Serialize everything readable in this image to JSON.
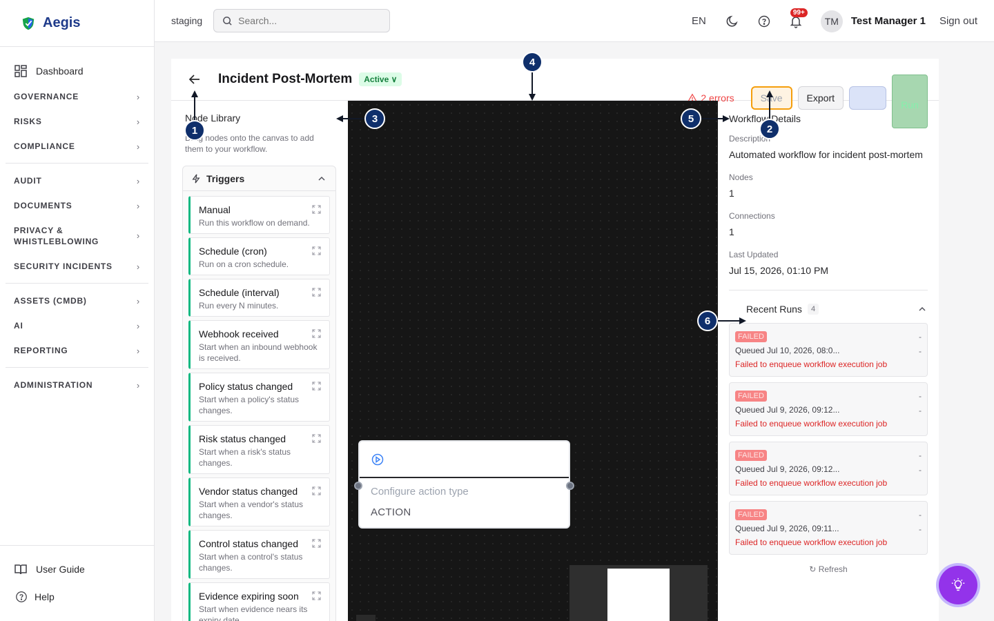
{
  "app": {
    "name": "Aegis"
  },
  "sidebar": {
    "dashboard": "Dashboard",
    "items": [
      {
        "label": "GOVERNANCE"
      },
      {
        "label": "RISKS"
      },
      {
        "label": "COMPLIANCE"
      },
      {
        "label": "AUDIT"
      },
      {
        "label": "DOCUMENTS"
      },
      {
        "label": "PRIVACY & WHISTLEBLOWING"
      },
      {
        "label": "SECURITY INCIDENTS"
      },
      {
        "label": "ASSETS (CMDB)"
      },
      {
        "label": "AI"
      },
      {
        "label": "REPORTING"
      },
      {
        "label": "ADMINISTRATION"
      }
    ],
    "user_guide": "User Guide",
    "help": "Help"
  },
  "topbar": {
    "env": "staging",
    "search_placeholder": "Search...",
    "lang": "EN",
    "notif_badge": "99+",
    "avatar": "TM",
    "user": "Test Manager 1",
    "signout": "Sign out"
  },
  "workflow": {
    "title": "Incident Post-Mortem",
    "status": "Active",
    "errors": "2 errors",
    "save": "Save",
    "export": "Export",
    "run": "Run"
  },
  "library": {
    "title": "Node Library",
    "desc": "Drag nodes onto the canvas to add them to your workflow.",
    "group": "Triggers",
    "nodes": [
      {
        "name": "Manual",
        "desc": "Run this workflow on demand."
      },
      {
        "name": "Schedule (cron)",
        "desc": "Run on a cron schedule."
      },
      {
        "name": "Schedule (interval)",
        "desc": "Run every N minutes."
      },
      {
        "name": "Webhook received",
        "desc": "Start when an inbound webhook is received."
      },
      {
        "name": "Policy status changed",
        "desc": "Start when a policy's status changes."
      },
      {
        "name": "Risk status changed",
        "desc": "Start when a risk's status changes."
      },
      {
        "name": "Vendor status changed",
        "desc": "Start when a vendor's status changes."
      },
      {
        "name": "Control status changed",
        "desc": "Start when a control's status changes."
      },
      {
        "name": "Evidence expiring soon",
        "desc": "Start when evidence nears its expiry date."
      }
    ]
  },
  "canvas": {
    "node_subtitle": "Configure action type",
    "node_type": "ACTION"
  },
  "details": {
    "title": "Workflow Details",
    "description_label": "Description",
    "description": "Automated workflow for incident post-mortem",
    "nodes_label": "Nodes",
    "nodes": "1",
    "connections_label": "Connections",
    "connections": "1",
    "updated_label": "Last Updated",
    "updated": "Jul 15, 2026, 01:10 PM",
    "runs_title": "Recent Runs",
    "runs_count": "4",
    "runs": [
      {
        "status": "FAILED",
        "queued": "Queued Jul 10, 2026, 08:0...",
        "dash1": "-",
        "dash2": "-",
        "error": "Failed to enqueue workflow execution job"
      },
      {
        "status": "FAILED",
        "queued": "Queued Jul 9, 2026, 09:12...",
        "dash1": "-",
        "dash2": "-",
        "error": "Failed to enqueue workflow execution job"
      },
      {
        "status": "FAILED",
        "queued": "Queued Jul 9, 2026, 09:12...",
        "dash1": "-",
        "dash2": "-",
        "error": "Failed to enqueue workflow execution job"
      },
      {
        "status": "FAILED",
        "queued": "Queued Jul 9, 2026, 09:11...",
        "dash1": "-",
        "dash2": "-",
        "error": "Failed to enqueue workflow execution job"
      }
    ],
    "refresh": "Refresh"
  },
  "annotations": [
    "1",
    "2",
    "3",
    "4",
    "5",
    "6"
  ],
  "colors": {
    "accent": "#1e3a8a",
    "trigger_border": "#10b981",
    "canvas_bg": "#161616",
    "error": "#dc2626",
    "save_highlight": "#f59e0b",
    "marker": "#0f2f6b"
  }
}
